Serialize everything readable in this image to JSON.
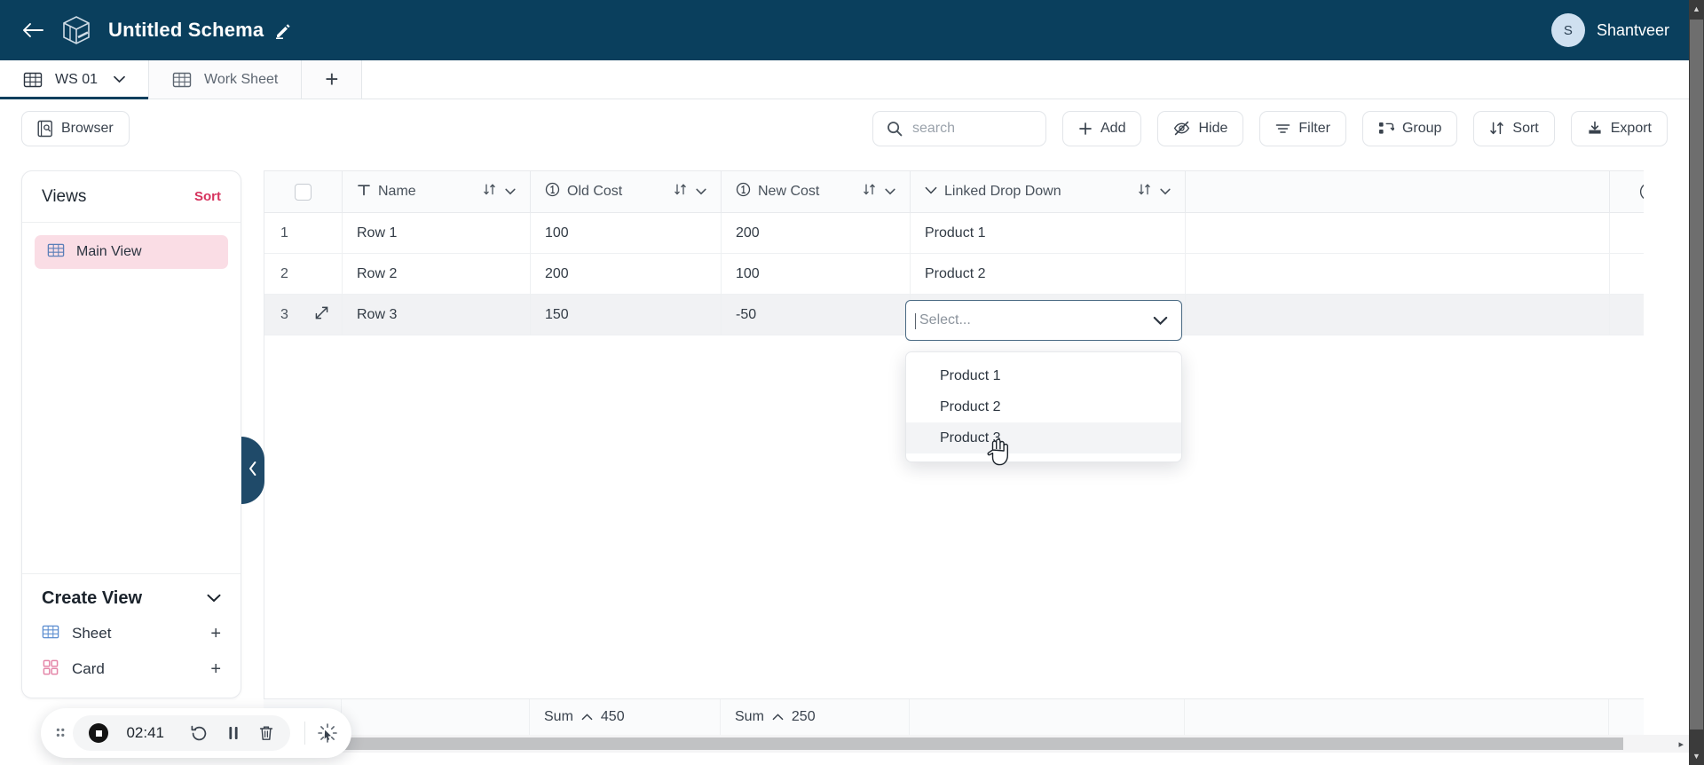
{
  "header": {
    "back_icon": "back-arrow-icon",
    "logo_icon": "cube-logo-icon",
    "title": "Untitled Schema",
    "edit_icon": "pencil-icon",
    "avatar_initial": "S",
    "user_name": "Shantveer",
    "bg_color": "#0a3f5d"
  },
  "tabs": [
    {
      "label": "WS 01",
      "icon": "grid-icon",
      "active": true,
      "has_caret": true
    },
    {
      "label": "Work Sheet",
      "icon": "grid-icon",
      "active": false,
      "has_caret": false
    }
  ],
  "tab_add_label": "+",
  "toolbar": {
    "browser_label": "Browser",
    "browser_icon": "browser-icon",
    "search_placeholder": "search",
    "search_value": "",
    "search_icon": "search-icon",
    "buttons": [
      {
        "label": "Add",
        "icon": "plus-icon"
      },
      {
        "label": "Hide",
        "icon": "eye-off-icon"
      },
      {
        "label": "Filter",
        "icon": "filter-icon"
      },
      {
        "label": "Group",
        "icon": "group-icon"
      },
      {
        "label": "Sort",
        "icon": "sort-icon"
      },
      {
        "label": "Export",
        "icon": "download-icon"
      }
    ]
  },
  "sidebar": {
    "views_title": "Views",
    "views_sort_label": "Sort",
    "views_sort_color": "#d6335e",
    "views": [
      {
        "label": "Main View",
        "icon": "grid-icon",
        "selected": true
      }
    ],
    "selected_bg": "#fadde5",
    "create_view": {
      "title": "Create View",
      "caret_icon": "chevron-down-icon",
      "items": [
        {
          "label": "Sheet",
          "icon": "grid-icon",
          "icon_color": "#5b8dd0",
          "add_label": "+"
        },
        {
          "label": "Card",
          "icon": "card-icon",
          "icon_color": "#e486a8",
          "add_label": "+"
        }
      ]
    },
    "collapse_icon": "chevron-left-icon"
  },
  "grid": {
    "select_all_checked": false,
    "columns": [
      {
        "label": "Name",
        "type_icon": "text-type-icon",
        "sort_icon": "sort-arrows-icon",
        "menu_icon": "chevron-down-icon"
      },
      {
        "label": "Old Cost",
        "type_icon": "number-type-icon",
        "sort_icon": "sort-arrows-icon",
        "menu_icon": "chevron-down-icon"
      },
      {
        "label": "New Cost",
        "type_icon": "number-type-icon",
        "sort_icon": "sort-arrows-icon",
        "menu_icon": "chevron-down-icon"
      },
      {
        "label": "Linked Drop Down",
        "type_icon": "chevron-down-icon",
        "sort_icon": "sort-arrows-icon",
        "menu_icon": "chevron-down-icon"
      }
    ],
    "add_column_icon": "plus-circle-icon",
    "rows": [
      {
        "index": "1",
        "name": "Row 1",
        "old_cost": "100",
        "new_cost": "200",
        "linked": "Product 1",
        "active": false
      },
      {
        "index": "2",
        "name": "Row 2",
        "old_cost": "200",
        "new_cost": "100",
        "linked": "Product 2",
        "active": false
      },
      {
        "index": "3",
        "name": "Row 3",
        "old_cost": "150",
        "new_cost": "-50",
        "linked": "",
        "active": true,
        "expand_icon": "expand-icon"
      }
    ],
    "editing_cell": {
      "placeholder": "Select...",
      "caret_icon": "chevron-down-icon",
      "border_color": "#4b6b84",
      "options": [
        {
          "label": "Product 1",
          "hovered": false
        },
        {
          "label": "Product 2",
          "hovered": false
        },
        {
          "label": "Product 3",
          "hovered": true
        }
      ]
    },
    "footer": [
      {
        "label": "Sum",
        "caret_icon": "chevron-up-icon",
        "value": "450"
      },
      {
        "label": "Sum",
        "caret_icon": "chevron-up-icon",
        "value": "250"
      }
    ]
  },
  "recorder": {
    "drag_handle_icon": "drag-dots-icon",
    "stop_icon": "stop-record-icon",
    "elapsed": "02:41",
    "restart_icon": "restart-icon",
    "pause_icon": "pause-icon",
    "delete_icon": "trash-icon",
    "highlight_icon": "click-sparkle-icon"
  },
  "scrollbars": {
    "h_arrow": "▸",
    "v_up_arrow": "▲",
    "v_down_arrow": "▼"
  }
}
